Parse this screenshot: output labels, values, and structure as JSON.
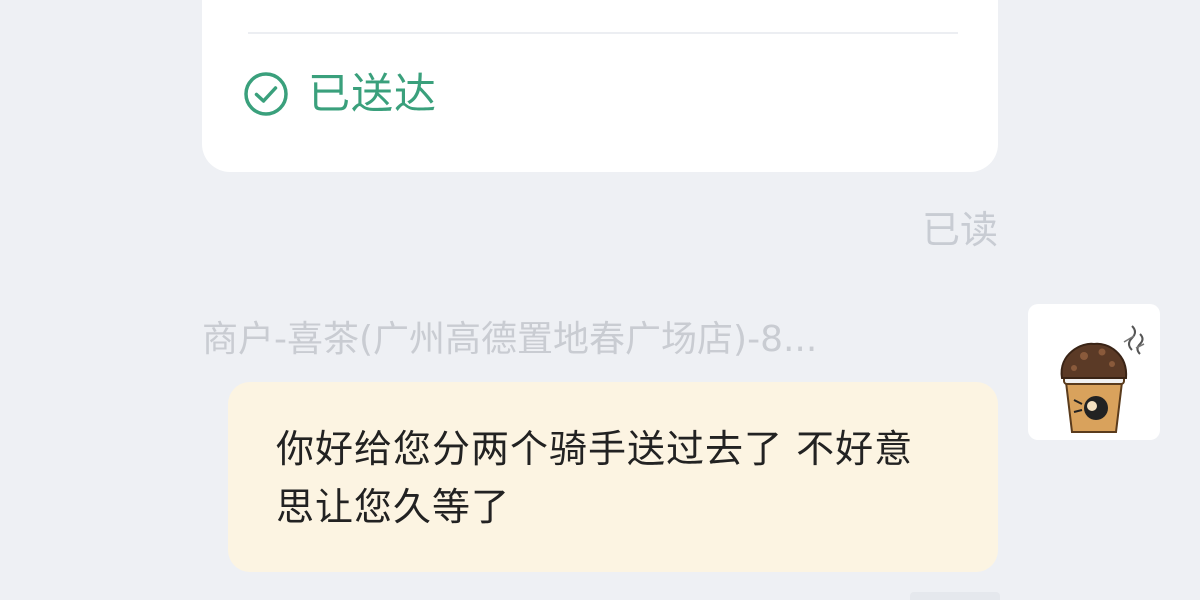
{
  "order_card": {
    "status_label": "已送达",
    "status_icon": "check-circle-icon",
    "status_color": "#3aa07c"
  },
  "read_receipt": "已读",
  "incoming_message": {
    "sender_name": "商户-喜茶(广州高德置地春广场店)-8...",
    "text": "你好给您分两个骑手送过去了 不好意思让您久等了",
    "avatar_icon": "bubble-tea-cup-avatar",
    "bubble_color": "#fcf4e2"
  }
}
